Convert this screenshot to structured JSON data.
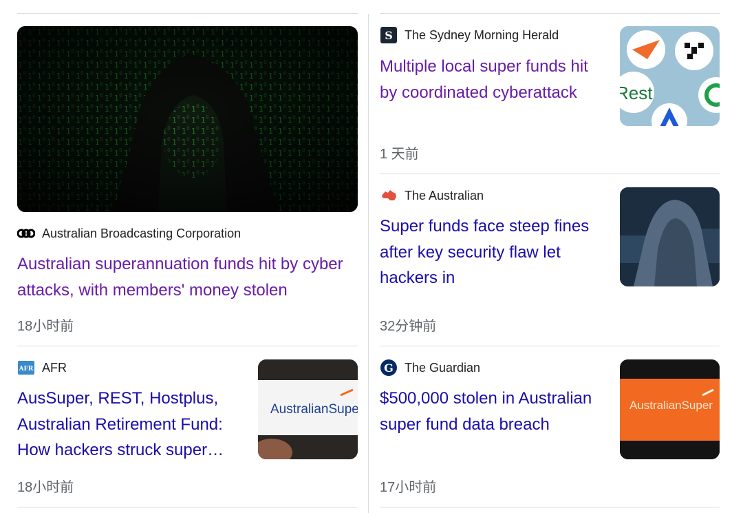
{
  "articles": [
    {
      "source": "Australian Broadcasting Corporation",
      "source_logo": "abc-logo-icon",
      "title": "Australian superannuation funds hit by cyber attacks, with members' money stolen",
      "time": "18小时前",
      "thumbnail": "hooded-hacker-green-code-image",
      "visited": true
    },
    {
      "source": "The Sydney Morning Herald",
      "source_logo": "smh-logo-icon",
      "title": "Multiple local super funds hit by coordinated cyberattack",
      "time": "1 天前",
      "thumbnail": "super-fund-logos-collage-image",
      "visited": true
    },
    {
      "source": "The Australian",
      "source_logo": "australia-map-icon",
      "title": "Super funds face steep fines after key security flaw let hackers in",
      "time": "32分钟前",
      "thumbnail": "hooded-hacker-monitor-image",
      "visited": false
    },
    {
      "source": "AFR",
      "source_logo": "afr-logo-icon",
      "title": "AusSuper, REST, Hostplus, Australian Retirement Fund: How hackers struck super…",
      "time": "18小时前",
      "thumbnail": "australiansuper-phone-image",
      "thumb_text": "AustralianSuper",
      "visited": false
    },
    {
      "source": "The Guardian",
      "source_logo": "guardian-logo-icon",
      "title": "$500,000 stolen in Australian super fund data breach",
      "time": "17小时前",
      "thumbnail": "australiansuper-orange-phone-image",
      "thumb_text": "AustralianSuper",
      "visited": false
    }
  ],
  "collage_fragment_text": "Rest",
  "colors": {
    "visited_link": "#681da8",
    "link": "#1a0dab",
    "meta": "#5f6368",
    "divider": "#dadce0"
  }
}
